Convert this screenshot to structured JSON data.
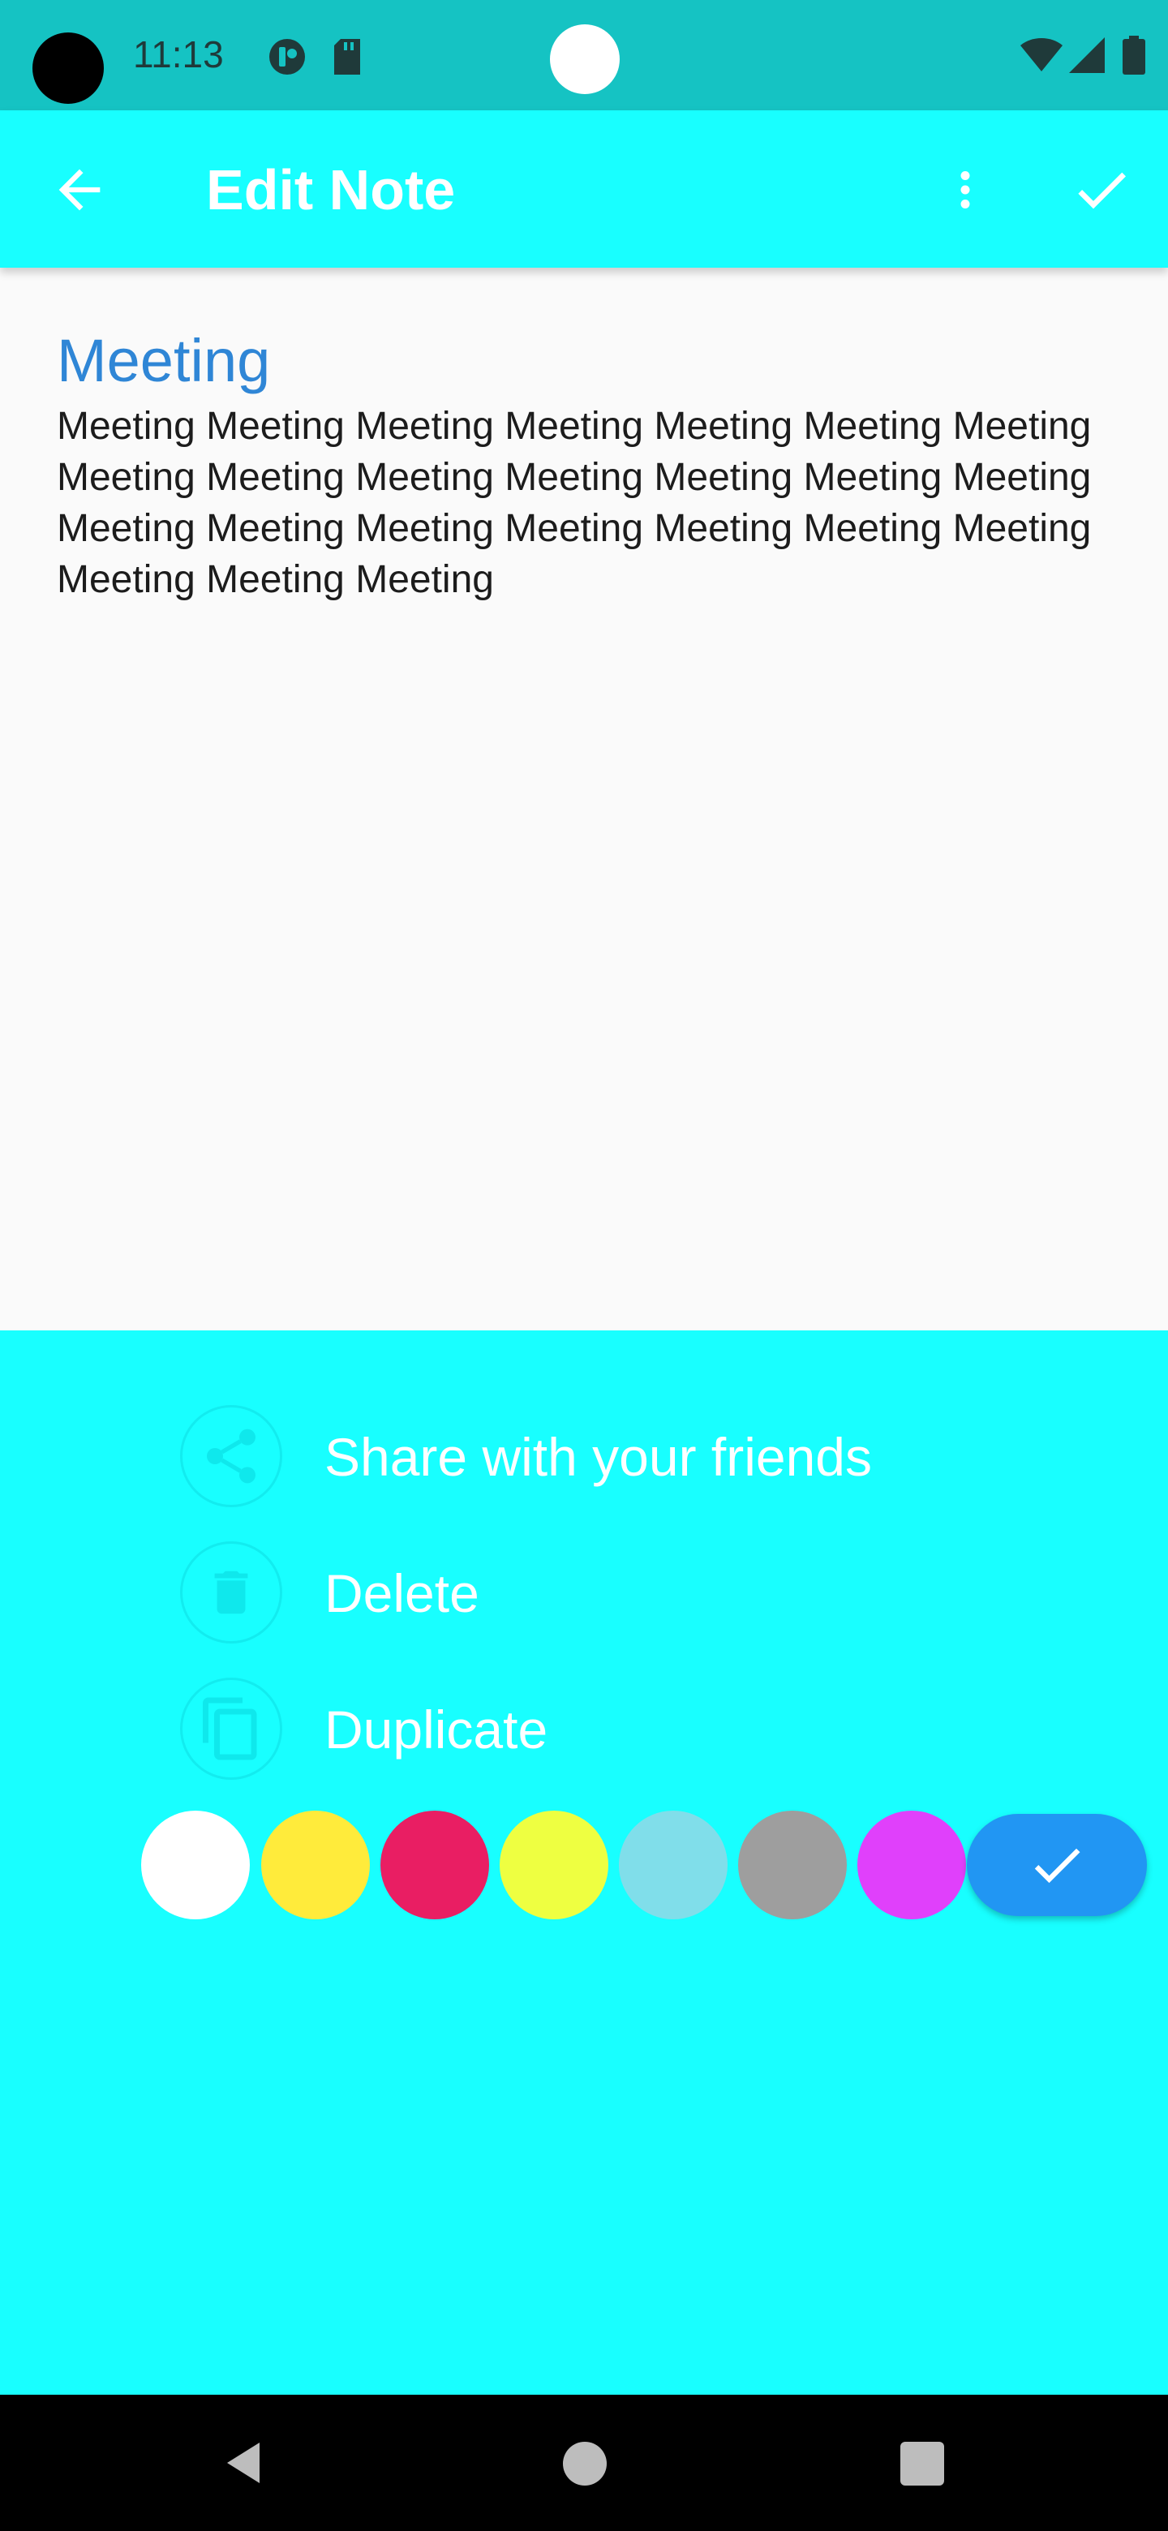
{
  "status_bar": {
    "time": "11:13"
  },
  "app_bar": {
    "title": "Edit Note"
  },
  "note": {
    "title": "Meeting",
    "body": "Meeting Meeting Meeting Meeting Meeting Meeting Meeting Meeting Meeting Meeting Meeting Meeting Meeting Meeting Meeting Meeting Meeting Meeting Meeting Meeting Meeting Meeting Meeting Meeting"
  },
  "sheet": {
    "menu": [
      {
        "label": "Share with your friends",
        "icon": "share-icon"
      },
      {
        "label": "Delete",
        "icon": "trash-icon"
      },
      {
        "label": "Duplicate",
        "icon": "copy-icon"
      }
    ],
    "colors": [
      "#FFFFFF",
      "#FFEB3B",
      "#E91E63",
      "#EEFF41",
      "#80DEEA",
      "#9E9E9E",
      "#E040FB"
    ],
    "confirm_color": "#2196F3"
  },
  "theme": {
    "status_bar": "#15C3C3",
    "app_bar": "#18FFFF",
    "accent_title": "#2F86D6"
  }
}
